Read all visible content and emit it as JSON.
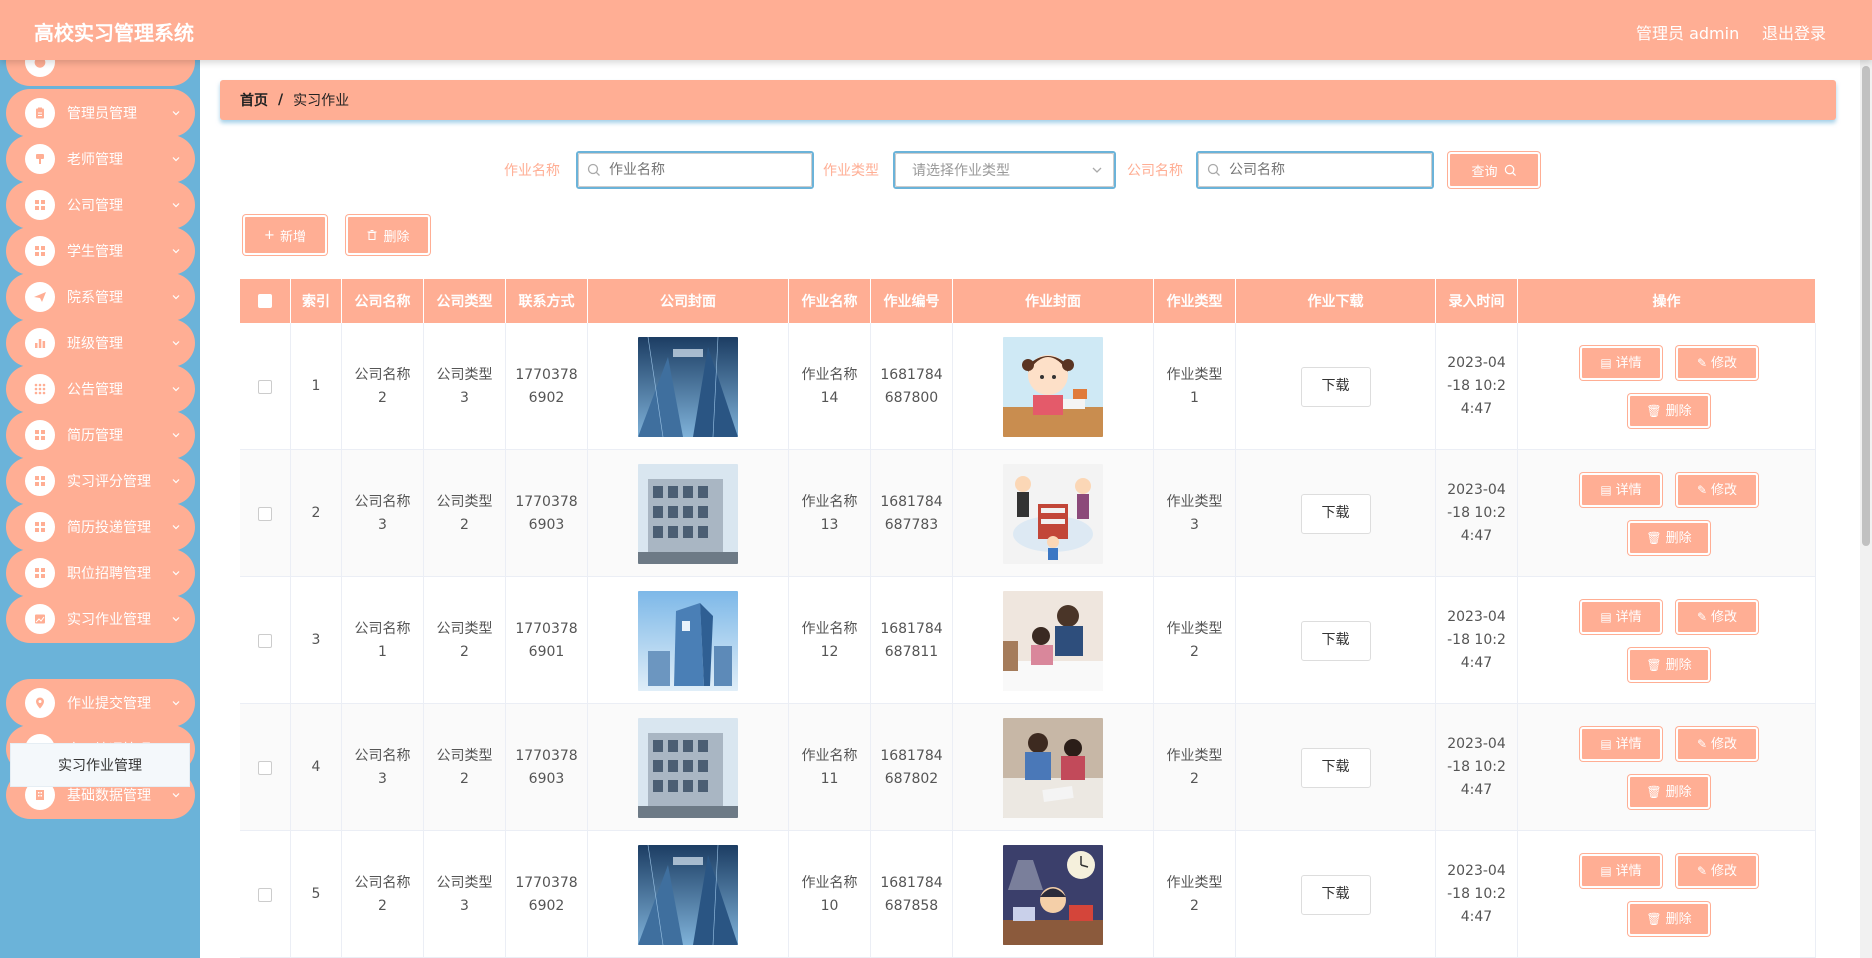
{
  "header": {
    "title": "高校实习管理系统",
    "user": "管理员 admin",
    "logout": "退出登录"
  },
  "sidebar": {
    "items": [
      {
        "label": "管理员管理",
        "icon": "clipboard-icon"
      },
      {
        "label": "老师管理",
        "icon": "podium-icon"
      },
      {
        "label": "公司管理",
        "icon": "grid-icon"
      },
      {
        "label": "学生管理",
        "icon": "grid-icon"
      },
      {
        "label": "院系管理",
        "icon": "paper-plane-icon"
      },
      {
        "label": "班级管理",
        "icon": "bar-chart-icon"
      },
      {
        "label": "公告管理",
        "icon": "apps-icon"
      },
      {
        "label": "简历管理",
        "icon": "grid-icon"
      },
      {
        "label": "实习评分管理",
        "icon": "grid-icon"
      },
      {
        "label": "简历投递管理",
        "icon": "grid-icon"
      },
      {
        "label": "职位招聘管理",
        "icon": "grid-icon"
      },
      {
        "label": "实习作业管理",
        "icon": "image-icon"
      },
      {
        "label": "作业提交管理",
        "icon": "location-icon"
      },
      {
        "label": "实习情况管理",
        "icon": "grid-icon"
      },
      {
        "label": "基础数据管理",
        "icon": "building-icon"
      }
    ],
    "active_sub": "实习作业管理"
  },
  "breadcrumb": {
    "home": "首页",
    "sep": "/",
    "current": "实习作业"
  },
  "search": {
    "name_label": "作业名称",
    "name_placeholder": "作业名称",
    "type_label": "作业类型",
    "type_placeholder": "请选择作业类型",
    "company_label": "公司名称",
    "company_placeholder": "公司名称",
    "query": "查询"
  },
  "actions": {
    "add": "新增",
    "delete": "删除"
  },
  "table": {
    "columns": [
      "索引",
      "公司名称",
      "公司类型",
      "联系方式",
      "公司封面",
      "作业名称",
      "作业编号",
      "作业封面",
      "作业类型",
      "作业下载",
      "录入时间",
      "操作"
    ],
    "download_label": "下载",
    "detail_label": "详情",
    "edit_label": "修改",
    "delete_label": "删除",
    "rows": [
      {
        "index": "1",
        "company": "公司名称\n2",
        "ctype": "公司类型\n3",
        "phone": "1770378\n6902",
        "cover": "glass",
        "hw_name": "作业名称\n14",
        "hw_no": "1681784\n687800",
        "hw_cover": "girl",
        "hw_type": "作业类型\n1",
        "time": "2023-04\n-18 10:2\n4:47"
      },
      {
        "index": "2",
        "company": "公司名称\n3",
        "ctype": "公司类型\n2",
        "phone": "1770378\n6903",
        "cover": "building",
        "hw_name": "作业名称\n13",
        "hw_no": "1681784\n687783",
        "hw_cover": "family",
        "hw_type": "作业类型\n3",
        "time": "2023-04\n-18 10:2\n4:47"
      },
      {
        "index": "3",
        "company": "公司名称\n1",
        "ctype": "公司类型\n2",
        "phone": "1770378\n6901",
        "cover": "tower",
        "hw_name": "作业名称\n12",
        "hw_no": "1681784\n687811",
        "hw_cover": "tutor",
        "hw_type": "作业类型\n2",
        "time": "2023-04\n-18 10:2\n4:47"
      },
      {
        "index": "4",
        "company": "公司名称\n3",
        "ctype": "公司类型\n2",
        "phone": "1770378\n6903",
        "cover": "building",
        "hw_name": "作业名称\n11",
        "hw_no": "1681784\n687802",
        "hw_cover": "kids",
        "hw_type": "作业类型\n2",
        "time": "2023-04\n-18 10:2\n4:47"
      },
      {
        "index": "5",
        "company": "公司名称\n2",
        "ctype": "公司类型\n3",
        "phone": "1770378\n6902",
        "cover": "glass",
        "hw_name": "作业名称\n10",
        "hw_no": "1681784\n687858",
        "hw_cover": "night",
        "hw_type": "作业类型\n2",
        "time": "2023-04\n-18 10:2\n4:47"
      }
    ]
  },
  "colors": {
    "accent": "#ffae94",
    "sidebar": "#6bb3d9"
  }
}
